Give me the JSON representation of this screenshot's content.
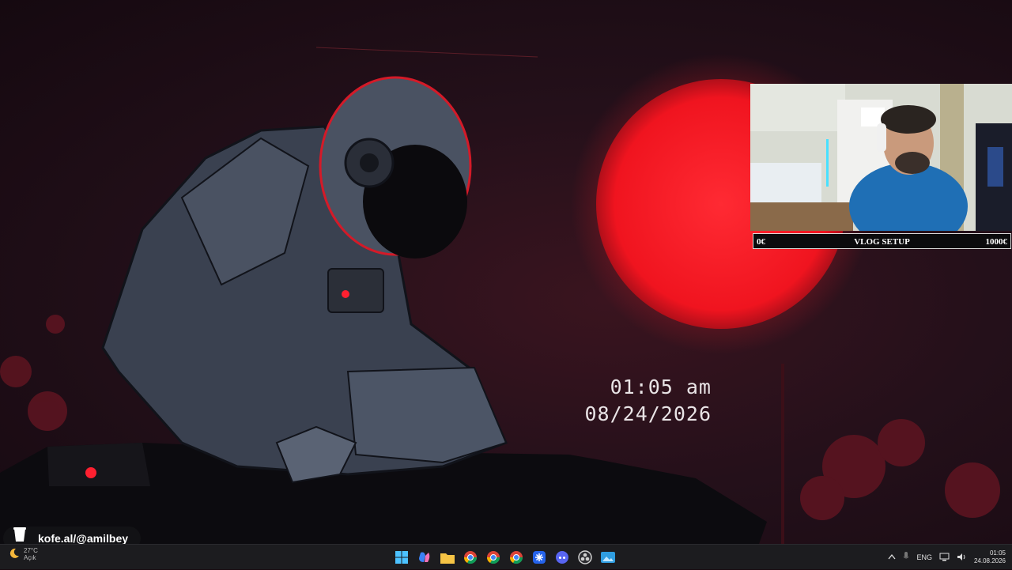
{
  "widget": {
    "time": "01:05 am",
    "date": "08/24/2026"
  },
  "stream_goal": {
    "min_label": "0€",
    "title": "VLOG SETUP",
    "max_label": "1000€",
    "progress": 0
  },
  "donation": {
    "icon": "cup-icon",
    "text": "kofe.al/@amilbey"
  },
  "taskbar": {
    "weather": {
      "icon": "moon-icon",
      "temp": "27°C",
      "condition": "Açık"
    },
    "apps": [
      {
        "name": "start-icon"
      },
      {
        "name": "copilot-icon"
      },
      {
        "name": "file-explorer-icon"
      },
      {
        "name": "chrome-icon"
      },
      {
        "name": "chrome-profile-icon"
      },
      {
        "name": "chrome-alt-icon"
      },
      {
        "name": "star-app-icon"
      },
      {
        "name": "discord-icon"
      },
      {
        "name": "obs-icon"
      },
      {
        "name": "photos-icon"
      }
    ],
    "tray": {
      "language": "ENG",
      "time": "01:05",
      "date": "24.08.2026"
    }
  },
  "colors": {
    "accent_red": "#ff1e2a",
    "taskbar_bg": "#1c1c1f"
  }
}
